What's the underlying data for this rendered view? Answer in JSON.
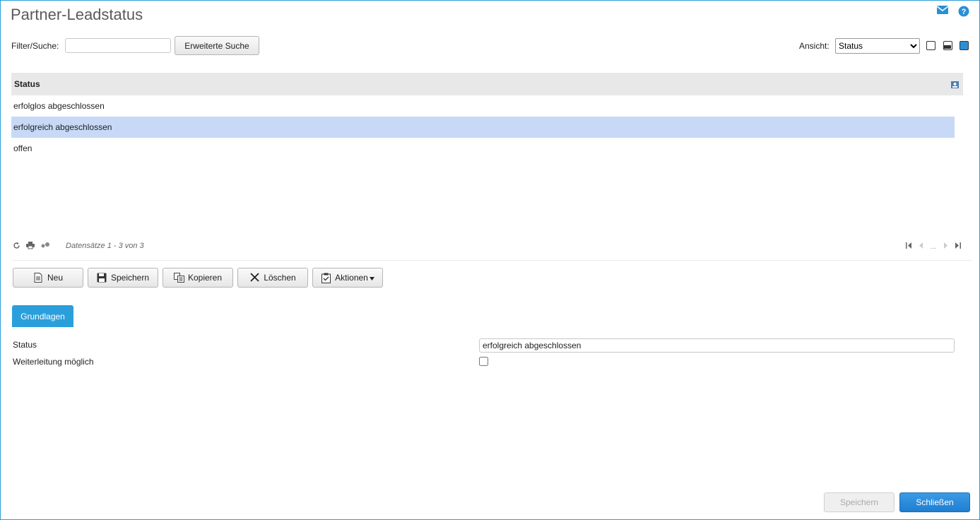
{
  "page": {
    "title": "Partner-Leadstatus"
  },
  "filter": {
    "label": "Filter/Suche:",
    "value": "",
    "extended_search_label": "Erweiterte Suche"
  },
  "view": {
    "label": "Ansicht:",
    "selected": "Status",
    "options": [
      "Status"
    ]
  },
  "grid": {
    "header": "Status",
    "rows": [
      "erfolglos abgeschlossen",
      "erfolgreich abgeschlossen",
      "offen"
    ],
    "selected_index": 1,
    "records_text": "Datensätze 1 - 3 von 3",
    "pager_ellipsis": "..."
  },
  "toolbar": {
    "new_label": "Neu",
    "save_label": "Speichern",
    "copy_label": "Kopieren",
    "delete_label": "Löschen",
    "actions_label": "Aktionen"
  },
  "tabs": {
    "basics": "Grundlagen"
  },
  "form": {
    "status_label": "Status",
    "status_value": "erfolgreich abgeschlossen",
    "forwarding_label": "Weiterleitung möglich",
    "forwarding_checked": false
  },
  "footer": {
    "save_label": "Speichern",
    "close_label": "Schließen"
  },
  "colors": {
    "accent": "#2b9fdb",
    "selected_row": "#c7d9f6",
    "header_bg": "#e8e8e8"
  }
}
